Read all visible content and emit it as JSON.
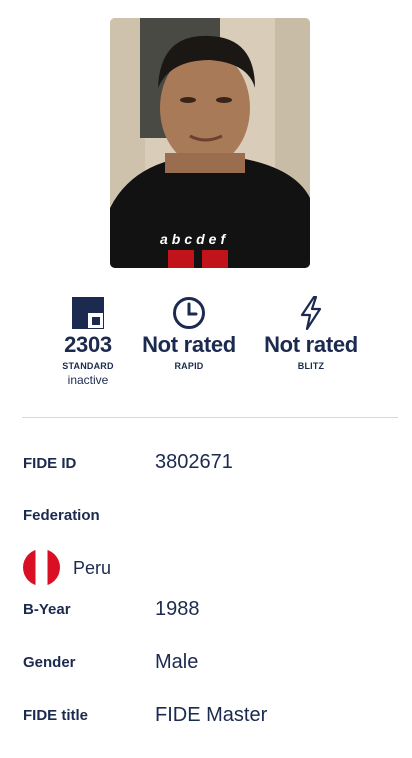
{
  "ratings": [
    {
      "icon": "standard-board-icon",
      "value": "2303",
      "label": "STANDARD",
      "status": "inactive"
    },
    {
      "icon": "clock-icon",
      "value": "Not rated",
      "label": "RAPID",
      "status": ""
    },
    {
      "icon": "lightning-icon",
      "value": "Not rated",
      "label": "BLITZ",
      "status": ""
    }
  ],
  "profile": {
    "fide_id_label": "FIDE ID",
    "fide_id_value": "3802671",
    "federation_label": "Federation",
    "federation_value": "Peru",
    "federation_flag": "peru-flag-icon",
    "byear_label": "B-Year",
    "byear_value": "1988",
    "gender_label": "Gender",
    "gender_value": "Male",
    "title_label": "FIDE title",
    "title_value": "FIDE Master"
  },
  "photo": {
    "shirt_text": "abcdef"
  },
  "colors": {
    "navy": "#1b2a4e",
    "divider": "#d6d8dc",
    "peru_red": "#d91023"
  }
}
